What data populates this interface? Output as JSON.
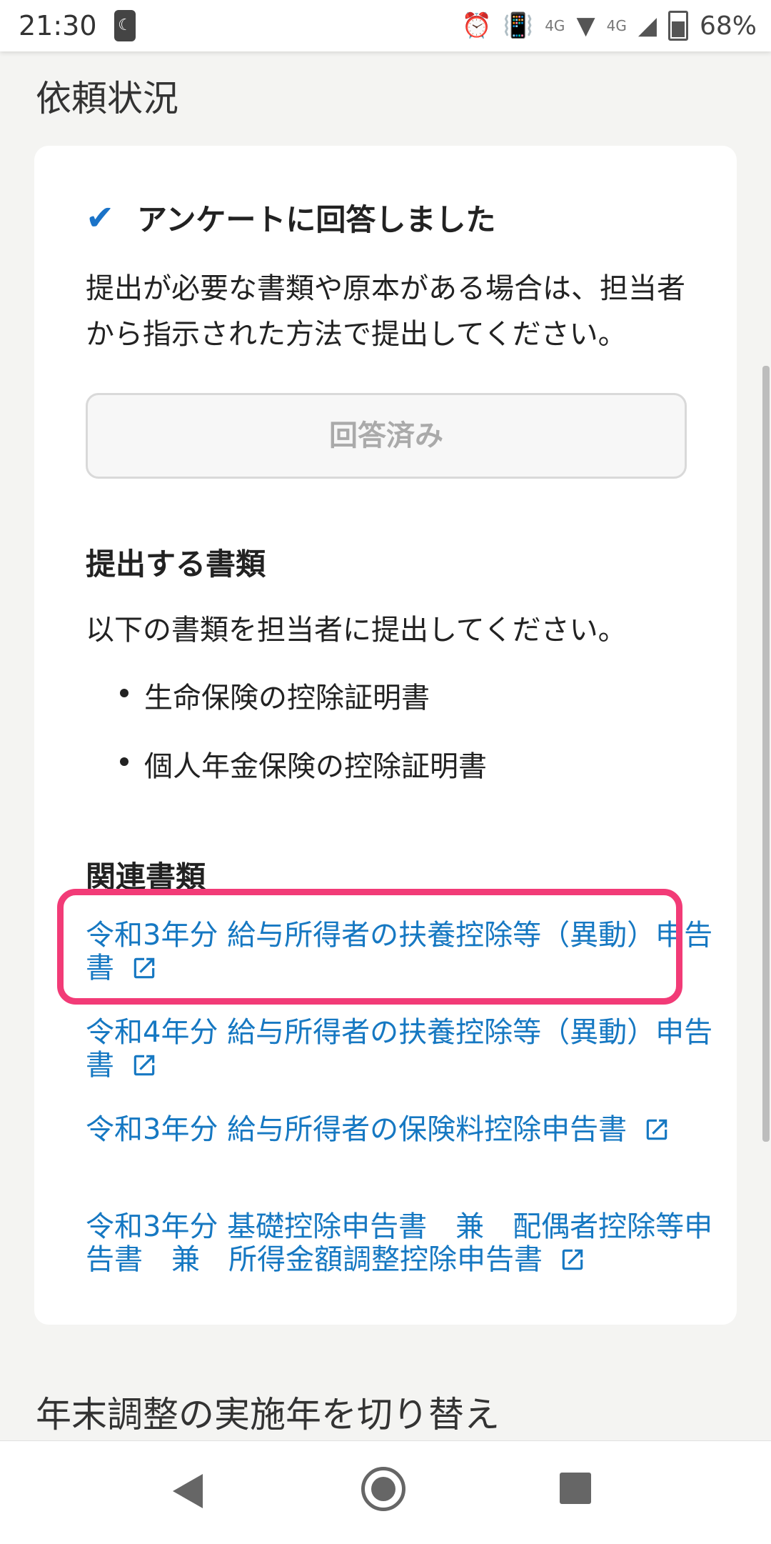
{
  "status": {
    "time": "21:30",
    "network": "4G",
    "network2": "4G",
    "battery": "68%"
  },
  "section": {
    "title": "依頼状況"
  },
  "card": {
    "status_text": "アンケートに回答しました",
    "instruction": "提出が必要な書類や原本がある場合は、担当者から指示された方法で提出してください。",
    "answered_button": "回答済み",
    "docs_heading": "提出する書類",
    "docs_desc": "以下の書類を担当者に提出してください。",
    "docs": [
      "生命保険の控除証明書",
      "個人年金保険の控除証明書"
    ],
    "related_heading": "関連書類",
    "related_links": [
      "令和3年分 給与所得者の扶養控除等（異動）申告書",
      "令和4年分 給与所得者の扶養控除等（異動）申告書",
      "令和3年分 給与所得者の保険料控除申告書",
      "令和3年分 基礎控除申告書　兼　配偶者控除等申告書　兼　所得金額調整控除申告書"
    ]
  },
  "switch_year": {
    "title": "年末調整の実施年を切り替え"
  },
  "colors": {
    "link": "#1678c2",
    "highlight": "#f23b77",
    "check": "#1a73c8"
  }
}
